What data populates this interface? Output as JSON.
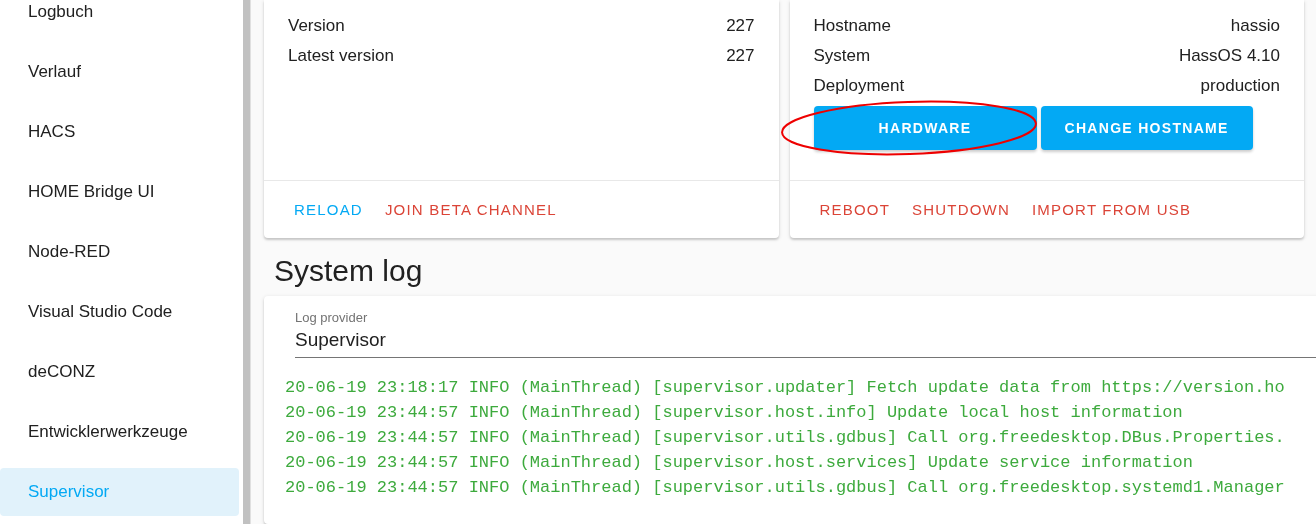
{
  "sidebar": {
    "items": [
      {
        "label": "Logbuch",
        "selected": false
      },
      {
        "label": "Verlauf",
        "selected": false
      },
      {
        "label": "HACS",
        "selected": false
      },
      {
        "label": "HOME Bridge UI",
        "selected": false
      },
      {
        "label": "Node-RED",
        "selected": false
      },
      {
        "label": "Visual Studio Code",
        "selected": false
      },
      {
        "label": "deCONZ",
        "selected": false
      },
      {
        "label": "Entwicklerwerkzeuge",
        "selected": false
      },
      {
        "label": "Supervisor",
        "selected": true
      }
    ]
  },
  "cards": [
    {
      "rows": [
        {
          "label": "Version",
          "value": "227"
        },
        {
          "label": "Latest version",
          "value": "227"
        }
      ],
      "actions": [
        {
          "label": "RELOAD",
          "kind": "primary"
        },
        {
          "label": "JOIN BETA CHANNEL",
          "kind": "warning"
        }
      ]
    },
    {
      "rows": [
        {
          "label": "Hostname",
          "value": "hassio"
        },
        {
          "label": "System",
          "value": "HassOS 4.10"
        },
        {
          "label": "Deployment",
          "value": "production"
        }
      ],
      "buttons": [
        {
          "label": "HARDWARE",
          "circled": true
        },
        {
          "label": "CHANGE HOSTNAME",
          "circled": false
        }
      ],
      "actions": [
        {
          "label": "REBOOT",
          "kind": "warning"
        },
        {
          "label": "SHUTDOWN",
          "kind": "warning"
        },
        {
          "label": "IMPORT FROM USB",
          "kind": "warning"
        }
      ]
    }
  ],
  "system_log": {
    "title": "System log",
    "provider": {
      "label": "Log provider",
      "value": "Supervisor"
    },
    "lines": [
      "20-06-19 23:18:17 INFO (MainThread) [supervisor.updater] Fetch update data from https://version.ho",
      "20-06-19 23:44:57 INFO (MainThread) [supervisor.host.info] Update local host information",
      "20-06-19 23:44:57 INFO (MainThread) [supervisor.utils.gdbus] Call org.freedesktop.DBus.Properties.",
      "20-06-19 23:44:57 INFO (MainThread) [supervisor.host.services] Update service information",
      "20-06-19 23:44:57 INFO (MainThread) [supervisor.utils.gdbus] Call org.freedesktop.systemd1.Manager"
    ]
  }
}
